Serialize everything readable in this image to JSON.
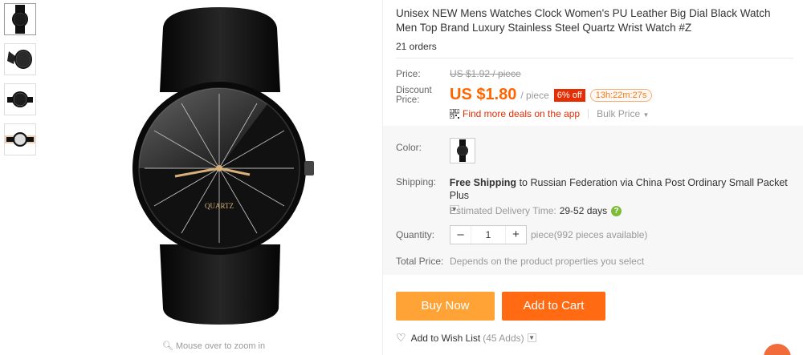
{
  "gallery": {
    "thumbnails": [
      "watch-front",
      "watch-side",
      "watch-back",
      "watch-wrist"
    ],
    "zoom_hint": "Mouse over to zoom in",
    "main_image_brand": "QUARTZ"
  },
  "product": {
    "title": "Unisex NEW Mens Watches Clock Women's PU Leather Big Dial Black Watch Men Top Brand Luxury Stainless Steel Quartz Wrist Watch #Z",
    "orders": "21 orders"
  },
  "pricing": {
    "price_label": "Price:",
    "old_price": "US $1.92 / piece",
    "discount_label_line1": "Discount",
    "discount_label_line2": "Price:",
    "current_price": "US $1.80",
    "per_unit": "/ piece",
    "discount_badge": "6% off",
    "timer": "13h:22m:27s",
    "deals_link": "Find more deals on the app",
    "bulk_price": "Bulk Price"
  },
  "options": {
    "color_label": "Color:",
    "shipping_label": "Shipping:",
    "shipping_free": "Free Shipping",
    "shipping_rest": "to Russian Federation via China Post Ordinary Small Packet Plus",
    "estimated_label": "Estimated Delivery Time:",
    "estimated_days": "29-52 days",
    "quantity_label": "Quantity:",
    "quantity_value": "1",
    "quantity_unit": "piece",
    "quantity_available": "(992 pieces available)",
    "total_label": "Total Price:",
    "total_value": "Depends on the product properties you select"
  },
  "actions": {
    "buy_now": "Buy Now",
    "add_to_cart": "Add to Cart",
    "wishlist": "Add to Wish List",
    "wishlist_count": "(45 Adds)"
  },
  "colors": {
    "accent_orange": "#ff6a12",
    "buy_orange": "#ffa336",
    "price_orange": "#ff6600",
    "badge_red": "#e62e04"
  },
  "icons": [
    "zoom-icon",
    "qr-code-icon",
    "chevron-down-icon",
    "question-icon",
    "heart-icon"
  ]
}
